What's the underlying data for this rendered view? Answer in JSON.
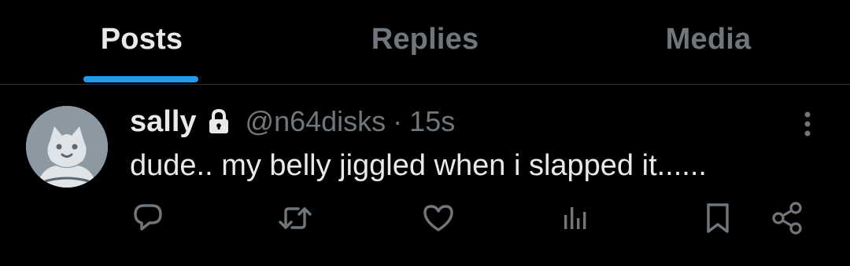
{
  "tabs": [
    {
      "label": "Posts",
      "active": true
    },
    {
      "label": "Replies",
      "active": false
    },
    {
      "label": "Media",
      "active": false
    }
  ],
  "colors": {
    "background": "#000000",
    "text_primary": "#e7e9ea",
    "text_secondary": "#71767b",
    "accent": "#1d9bf0",
    "divider": "#2f3336",
    "avatar": "#8c99a3"
  },
  "post": {
    "display_name": "sally",
    "protected": true,
    "handle": "@n64disks",
    "separator": "·",
    "time": "15s",
    "text": "dude.. my belly jiggled when i slapped it......",
    "avatar_icon": "avatar-icon",
    "actions": [
      "reply-icon",
      "retweet-icon",
      "like-icon",
      "views-icon",
      "bookmark-icon",
      "share-icon"
    ],
    "more_icon": "more-vertical-icon"
  }
}
